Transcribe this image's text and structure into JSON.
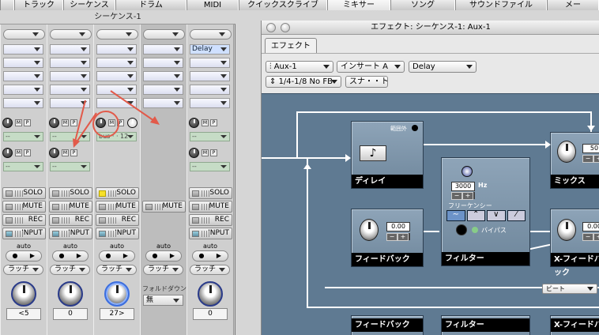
{
  "tabs": [
    "トラック",
    "シーケンス",
    "ドラム",
    "MIDI",
    "クイックスクライブ",
    "ミキサー",
    "ソング",
    "サウンドファイル",
    "メー"
  ],
  "active_tab": "ミキサー",
  "sequence_title": "シーケンス-1",
  "strips": [
    {
      "insert_top": "",
      "send1": "--",
      "send2": "--",
      "solo": "SOLO",
      "mute": "MUTE",
      "rec": "REC",
      "input": "INPUT",
      "auto": "auto",
      "latch": "ラッチ",
      "value": "<5"
    },
    {
      "insert_top": "",
      "send1": "--",
      "send2": "--",
      "solo": "SOLO",
      "mute": "MUTE",
      "rec": "REC",
      "input": "INPUT",
      "auto": "auto",
      "latch": "ラッチ",
      "value": "0"
    },
    {
      "insert_top": "",
      "send1": "bus · · 12",
      "send2": "--",
      "solo": "SOLO",
      "mute": "MUTE",
      "rec": "REC",
      "input": "INPUT",
      "auto": "auto",
      "latch": "ラッチ",
      "value": "27>"
    },
    {
      "mute": "MUTE",
      "auto": "auto",
      "latch": "ラッチ",
      "fold_label": "フォルドダウン",
      "fold_value": "無"
    },
    {
      "insert_top": "Delay",
      "send1": "--",
      "send2": "--",
      "solo": "SOLO",
      "mute": "MUTE",
      "rec": "REC",
      "input": "INPUT",
      "auto": "auto",
      "latch": "ラッチ",
      "value": "0"
    }
  ],
  "mp_labels": {
    "m": "M",
    "p": "P"
  },
  "effect_window": {
    "title": "エフェクト: シーケンス-1: Aux-1",
    "tab": "エフェクト",
    "aux_dropdown": "Aux-1",
    "insert_dropdown": "インサート A",
    "effect_dropdown": "Delay",
    "preset_dropdown": "1/4-1/8 No FB",
    "snapshot_button": "スナ・・ト",
    "modules": {
      "delay": "ディレイ",
      "range_out": "範囲外",
      "mix": "ミックス",
      "mix_value": "50",
      "feedback": "フィードバック",
      "feedback_value": "0.00",
      "filter": "フィルター",
      "freq_value": "3000",
      "freq_unit": "Hz",
      "freq_label": "フリーケンシー",
      "bypass": "バイパス",
      "x_feedback": "X-フィードバック",
      "x_feedback_value": "0.00",
      "beat": "ビート",
      "feedback2": "フィードバック",
      "filter2": "フィルター",
      "x_feedback2": "X-フィードバッ"
    }
  }
}
